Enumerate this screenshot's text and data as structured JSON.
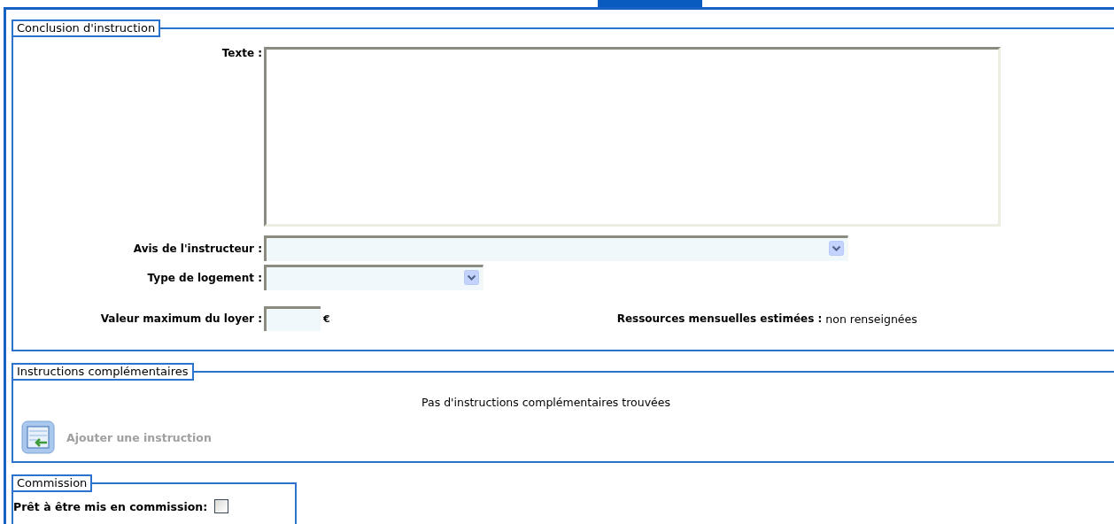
{
  "conclusion": {
    "legend": "Conclusion d'instruction",
    "text_label": "Texte :",
    "opinion_label": "Avis de l'instructeur :",
    "housing_label": "Type de logement :",
    "rent_label": "Valeur maximum du loyer :",
    "rent_unit": "€",
    "resources_label": "Ressources mensuelles estimées :",
    "resources_value": "non renseignées"
  },
  "complementary": {
    "legend": "Instructions complémentaires",
    "empty_message": "Pas d'instructions complémentaires trouvées",
    "add_label": "Ajouter une instruction",
    "add_disabled": true
  },
  "commission": {
    "legend": "Commission",
    "ready_label": "Prêt à être mis en commission:",
    "ready_checked": false
  }
}
